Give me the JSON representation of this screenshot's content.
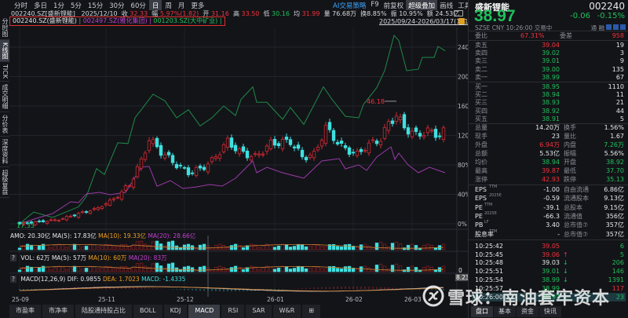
{
  "top_nav": {
    "periods": [
      "分时",
      "多日",
      "1分",
      "5分",
      "15分",
      "30分",
      "60分",
      "日",
      "周",
      "月",
      "更多"
    ],
    "active_period": "日",
    "tools": [
      "AI交易策略",
      "F9",
      "前复权",
      "超级叠加",
      "画线",
      "工具"
    ],
    "active_tool": "超级叠加",
    "icons": [
      "gear-icon",
      "help-icon",
      "chevron-right-icon"
    ],
    "gear": "⚙",
    "help": "?",
    "more": "›"
  },
  "info_bar": {
    "code": "002240.SZ[盛新锂能]",
    "date": "2025/12/10",
    "close_label": "收",
    "close": "32.33",
    "change_label": "幅",
    "change": "5.97%(1.82)",
    "open_label": "开",
    "open": "31.16",
    "high_label": "高",
    "high": "33.50",
    "low_label": "低",
    "low": "30.16",
    "avg_label": "均",
    "avg": "31.99",
    "vol_label": "量",
    "vol": "76.68万",
    "turnover_label": "换",
    "turnover": "8.85%",
    "amp_label": "振",
    "amp": "10.95%",
    "amount_label": "额",
    "amount": "24.53亿"
  },
  "overlay_legend": {
    "items": [
      "002240.SZ(盛新锂能)",
      "002497.SZ(雅化集团)",
      "001203.SZ(大中矿业)"
    ],
    "colors": [
      "#e6e8eb",
      "#c040d0",
      "#20c05c"
    ],
    "separator": "|"
  },
  "date_range": "2025/09/24-2026/03/17(111日)▼",
  "sidebar": [
    "分时图",
    "K线图",
    "TICK",
    "成交明细",
    "分价表",
    "深度资料",
    "超级复盘"
  ],
  "sidebar_active": "K线图",
  "indicators": {
    "amo": {
      "name": "AMO: 20.30亿",
      "ma5": "MA(5): 17.83亿",
      "ma10": "MA(10): 19.33亿",
      "ma20": "MA(20): 28.66亿"
    },
    "vol": {
      "q": "?",
      "name": "VOL: 62万",
      "ma5": "MA(5): 57万",
      "ma10": "MA(10): 60万",
      "ma20": "MA(20): 83万",
      "zero": "0"
    },
    "macd": {
      "q": "?",
      "name": "MACD(12,26,9)",
      "dif": "DIF: 0.9855",
      "dea": "DEA: 1.7023",
      "macd": "MACD: -1.4335",
      "marker": "8.2379"
    }
  },
  "bottom_tabs": [
    "市盈率",
    "市净率",
    "陆股通持股占比",
    "BOLL",
    "KDJ",
    "MACD",
    "RSI",
    "SAR",
    "W&R",
    "⊞"
  ],
  "bottom_active": "MACD",
  "quote": {
    "name": "盛新锂能",
    "code": "002240",
    "price": "38.97",
    "change": "-0.06",
    "change_pct": "-0.15%",
    "exchange": "SZSE",
    "currency": "CNY",
    "time": "10:26:00",
    "status": "交易中",
    "flags": [
      "通",
      "融"
    ]
  },
  "order_book": {
    "ratio_label": "委比",
    "ratio": "67.31%",
    "diff_label": "委差",
    "diff": "958",
    "asks": [
      {
        "label": "卖五",
        "price": "39.04",
        "vol": "19",
        "color": "red"
      },
      {
        "label": "卖四",
        "price": "39.02",
        "vol": "3",
        "color": "green"
      },
      {
        "label": "卖三",
        "price": "39.01",
        "vol": "9",
        "color": "green"
      },
      {
        "label": "卖二",
        "price": "39.00",
        "vol": "135",
        "color": "green"
      },
      {
        "label": "卖一",
        "price": "38.99",
        "vol": "67",
        "color": "green"
      }
    ],
    "bids": [
      {
        "label": "买一",
        "price": "38.95",
        "vol": "1110",
        "color": "green"
      },
      {
        "label": "买二",
        "price": "38.94",
        "vol": "11",
        "color": "green"
      },
      {
        "label": "买三",
        "price": "38.93",
        "vol": "21",
        "color": "green"
      },
      {
        "label": "买四",
        "price": "38.92",
        "vol": "44",
        "color": "green"
      },
      {
        "label": "买五",
        "price": "38.91",
        "vol": "5",
        "color": "green"
      }
    ]
  },
  "stats": [
    {
      "l1": "总量",
      "v1": "14.20万",
      "c1": "white",
      "l2": "换手",
      "v2": "1.56%",
      "c2": "white"
    },
    {
      "l1": "现手",
      "v1": "23",
      "c1": "white",
      "l2": "量比",
      "v2": "1.67",
      "c2": "white"
    },
    {
      "l1": "外盘",
      "v1": "6.94万",
      "c1": "red",
      "l2": "内盘",
      "v2": "7.26万",
      "c2": "green"
    },
    {
      "l1": "总额",
      "v1": "5.53亿",
      "c1": "white",
      "l2": "振幅",
      "v2": "5.56%",
      "c2": "white"
    },
    {
      "l1": "均价",
      "v1": "38.94",
      "c1": "green",
      "l2": "开盘",
      "v2": "38.92",
      "c2": "green"
    },
    {
      "l1": "最高",
      "v1": "39.87",
      "c1": "red",
      "l2": "最低",
      "v2": "37.70",
      "c2": "green"
    },
    {
      "l1": "涨停",
      "v1": "42.93",
      "c1": "red",
      "l2": "跌停",
      "v2": "35.13",
      "c2": "green"
    }
  ],
  "fundamentals": [
    {
      "l1": "EPS",
      "s1": "TTM",
      "v1": "-1.00",
      "l2": "自由流通",
      "v2": "6.86亿"
    },
    {
      "l1": "EPS",
      "s1": "2025E",
      "v1": "-0.59",
      "l2": "流通股本",
      "v2": "9.13亿"
    },
    {
      "l1": "PE",
      "s1": "TTM",
      "v1": "-39.1",
      "l2": "总股本",
      "v2": "9.15亿"
    },
    {
      "l1": "PE",
      "s1": "2025E",
      "v1": "-66.3",
      "l2": "流通值",
      "v2": "356亿"
    },
    {
      "l1": "PB",
      "s1": "LF",
      "v1": "3.40",
      "l2": "总市值⑦",
      "v2": "357亿"
    },
    {
      "l1": "股息率",
      "s1": "TTM",
      "v1": "-",
      "l2": "总市值⑦",
      "v2": "357亿"
    }
  ],
  "ticks": [
    {
      "time": "10:25:42",
      "price": "39.05",
      "pc": "red",
      "arrow": "",
      "ac": "red",
      "vol": "6",
      "vc": "green"
    },
    {
      "time": "10:25:45",
      "price": "39.06",
      "pc": "red",
      "arrow": "↑",
      "ac": "red",
      "vol": "5",
      "vc": "green"
    },
    {
      "time": "10:25:48",
      "price": "39.03",
      "pc": "white",
      "arrow": "↓",
      "ac": "green",
      "vol": "206",
      "vc": "green"
    },
    {
      "time": "10:25:51",
      "price": "39.01",
      "pc": "green",
      "arrow": "↓",
      "ac": "green",
      "vol": "146",
      "vc": "green"
    },
    {
      "time": "10:25:54",
      "price": "38.99",
      "pc": "green",
      "arrow": "↓",
      "ac": "green",
      "vol": "1391",
      "vc": "green"
    },
    {
      "time": "10:25:57",
      "price": "38.99",
      "pc": "green",
      "arrow": "",
      "ac": "green",
      "vol": "117",
      "vc": "red"
    },
    {
      "time": "10:26:00",
      "price": "38.97",
      "pc": "green",
      "arrow": "↓",
      "ac": "green",
      "vol": "23",
      "vc": "green"
    }
  ],
  "panel_tabs": [
    "盘口",
    "基本",
    "资金",
    "快讯"
  ],
  "panel_active": "盘口",
  "watermark": "雪球：南油套牢资本",
  "chart_data": {
    "type": "line",
    "title": "002240.SZ 超级叠加 (relative %)",
    "y_ticks": [
      "0%",
      "40%",
      "80%",
      "120%",
      "160%",
      "200%",
      "240%"
    ],
    "ylim": [
      0,
      260
    ],
    "x_ticks": [
      {
        "label": "25-09",
        "day": 0
      },
      {
        "label": "25-11",
        "day": 22
      },
      {
        "label": "25-12",
        "day": 42
      },
      {
        "label": "26-01",
        "day": 65
      },
      {
        "label": "26-02",
        "day": 85
      },
      {
        "label": "26-03",
        "day": 100
      }
    ],
    "base_price": 17.33,
    "min_label": "17.33",
    "max_label": "46.18",
    "main_price_keypoints": [
      [
        0,
        17.33
      ],
      [
        10,
        18.3
      ],
      [
        15,
        19.7
      ],
      [
        20,
        21.0
      ],
      [
        25,
        23.8
      ],
      [
        28,
        26.6
      ],
      [
        31,
        32.1
      ],
      [
        33,
        37.3
      ],
      [
        36,
        34.3
      ],
      [
        40,
        31.2
      ],
      [
        43,
        29.4
      ],
      [
        46,
        30.2
      ],
      [
        49,
        32.1
      ],
      [
        53,
        36.7
      ],
      [
        56,
        34.3
      ],
      [
        60,
        33.0
      ],
      [
        64,
        36.2
      ],
      [
        69,
        36.75
      ],
      [
        72,
        33.0
      ],
      [
        75,
        33.6
      ],
      [
        78,
        39.9
      ],
      [
        82,
        35.45
      ],
      [
        86,
        33.6
      ],
      [
        88,
        35.45
      ],
      [
        92,
        37.3
      ],
      [
        94,
        41.0
      ],
      [
        96,
        42.85
      ],
      [
        98,
        40.0
      ],
      [
        101,
        38.2
      ],
      [
        104,
        39.15
      ],
      [
        107,
        38.2
      ],
      [
        108,
        38.97
      ]
    ],
    "series": [
      {
        "name": "001203.SZ(大中矿业)",
        "color": "#1f8a4a",
        "points": [
          [
            0,
            0
          ],
          [
            3.6,
            16
          ],
          [
            8.4,
            8.5
          ],
          [
            15,
            23
          ],
          [
            17,
            37
          ],
          [
            19.6,
            75
          ],
          [
            21.6,
            67
          ],
          [
            25,
            110
          ],
          [
            27.6,
            109
          ],
          [
            29.4,
            144
          ],
          [
            31,
            155
          ],
          [
            34,
            176
          ],
          [
            37,
            167
          ],
          [
            40,
            144
          ],
          [
            43,
            155
          ],
          [
            46,
            133
          ],
          [
            49,
            144
          ],
          [
            52,
            160
          ],
          [
            55,
            147
          ],
          [
            56.4,
            169
          ],
          [
            59.4,
            186
          ],
          [
            60.4,
            165
          ],
          [
            63,
            165
          ],
          [
            67,
            142
          ],
          [
            69,
            158
          ],
          [
            72.4,
            135
          ],
          [
            77.4,
            186
          ],
          [
            79.6,
            169
          ],
          [
            83,
            146
          ],
          [
            86.4,
            144
          ],
          [
            87.6,
            162
          ],
          [
            91,
            185
          ],
          [
            93,
            208
          ],
          [
            95.4,
            256
          ],
          [
            96.6,
            249
          ],
          [
            98.6,
            208
          ],
          [
            101.6,
            210
          ],
          [
            102.6,
            226
          ],
          [
            105.6,
            226
          ],
          [
            106.6,
            241
          ],
          [
            108.4,
            235
          ]
        ]
      },
      {
        "name": "002497.SZ(雅化集团)",
        "color": "#9a3aa8",
        "points": [
          [
            0,
            0
          ],
          [
            5,
            8.5
          ],
          [
            8.4,
            13.9
          ],
          [
            13,
            29.9
          ],
          [
            15,
            28.8
          ],
          [
            17,
            40.5
          ],
          [
            20.4,
            42.7
          ],
          [
            23,
            39.5
          ],
          [
            27,
            42.7
          ],
          [
            31,
            77
          ],
          [
            33,
            77.9
          ],
          [
            35,
            51
          ],
          [
            38.4,
            58.7
          ],
          [
            41.6,
            48
          ],
          [
            45,
            50
          ],
          [
            48.4,
            53.3
          ],
          [
            51.6,
            51.2
          ],
          [
            55,
            61.9
          ],
          [
            59.4,
            85.3
          ],
          [
            60.4,
            69.3
          ],
          [
            63,
            76.8
          ],
          [
            67,
            69.3
          ],
          [
            72.4,
            61.9
          ],
          [
            77,
            85.3
          ],
          [
            81.4,
            88.5
          ],
          [
            83,
            74.7
          ],
          [
            86.4,
            80
          ],
          [
            88.4,
            72.5
          ],
          [
            91,
            90.7
          ],
          [
            94.6,
            104.5
          ],
          [
            95.6,
            87.5
          ],
          [
            96.6,
            96
          ],
          [
            99,
            80
          ],
          [
            101.6,
            69.3
          ],
          [
            104.4,
            76.8
          ],
          [
            108.4,
            69.3
          ]
        ]
      }
    ]
  }
}
